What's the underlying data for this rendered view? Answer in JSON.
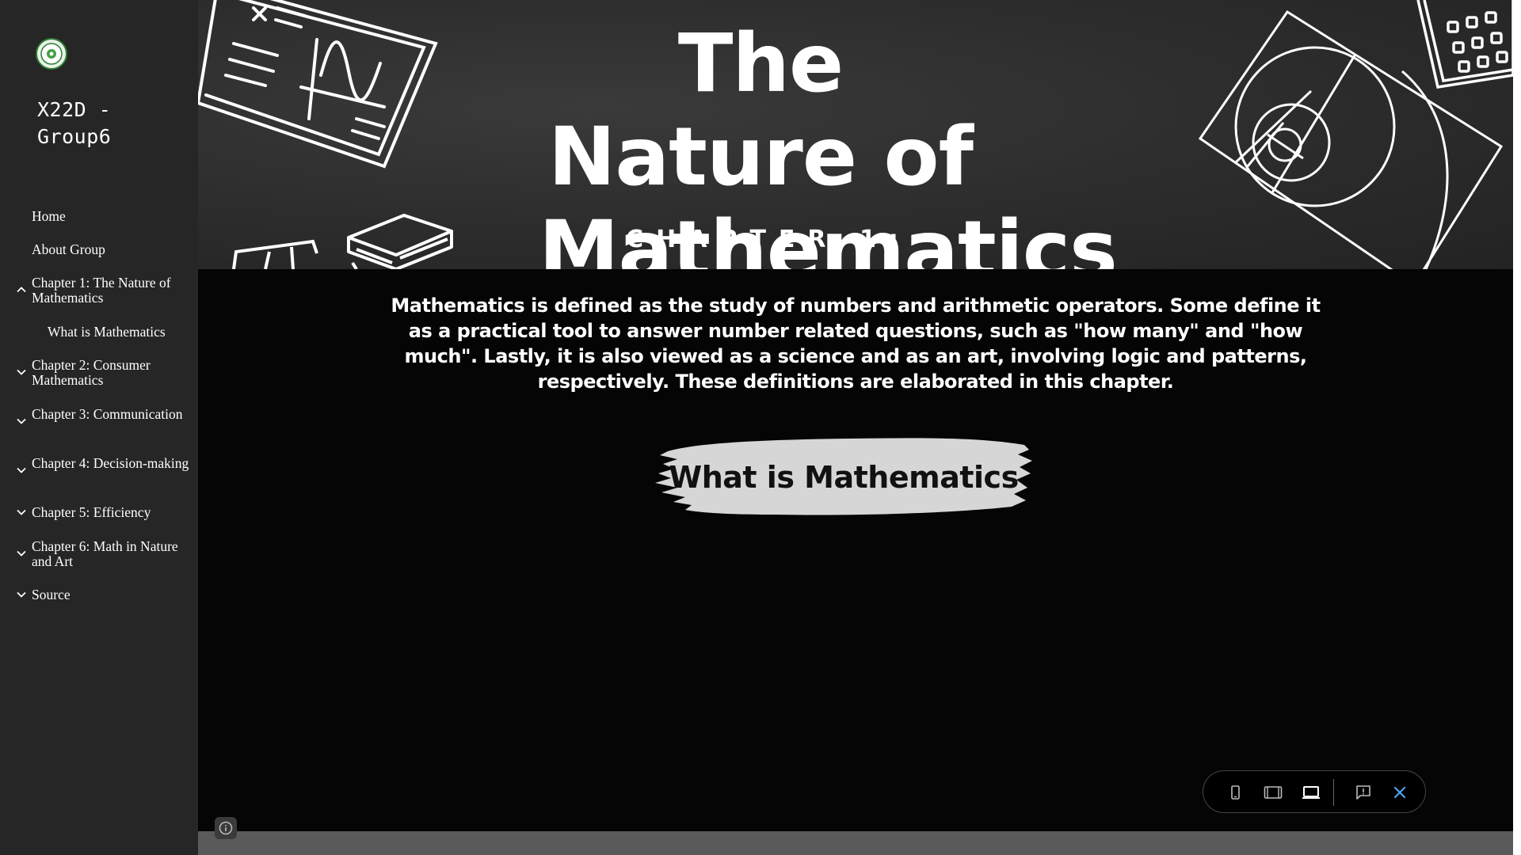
{
  "site": {
    "title": "X22D -\nGroup6",
    "logo_icon": "school-seal-icon"
  },
  "sidebar": {
    "items": [
      {
        "label": "Home",
        "expandable": false
      },
      {
        "label": "About Group",
        "expandable": false
      },
      {
        "label": "Chapter 1: The Nature of Mathematics",
        "expandable": true,
        "expanded": true
      },
      {
        "label": "What is Mathematics",
        "expandable": false,
        "sub": true
      },
      {
        "label": "Chapter 2: Consumer Mathematics",
        "expandable": true,
        "expanded": false
      },
      {
        "label": "Chapter 3: Communication",
        "expandable": true,
        "expanded": false
      },
      {
        "label": "Chapter 4: Decision-making",
        "expandable": true,
        "expanded": false
      },
      {
        "label": "Chapter 5: Efficiency",
        "expandable": true,
        "expanded": false
      },
      {
        "label": "Chapter 6: Math in Nature and Art",
        "expandable": true,
        "expanded": false
      },
      {
        "label": "Source",
        "expandable": true,
        "expanded": false
      }
    ]
  },
  "banner": {
    "title": "The Nature of Mathematics",
    "chapter": "CHAPTER 1:"
  },
  "main": {
    "intro": "Mathematics is defined as the study of numbers and arithmetic operators. Some define it as a practical tool to answer number related questions, such as \"how many\" and \"how much\". Lastly, it is also viewed as a science and as an art, involving logic and patterns, respectively. These definitions are elaborated in this chapter.",
    "cta_label": "What is Mathematics"
  },
  "preview_toolbar": {
    "buttons": [
      "phone-view-icon",
      "tablet-view-icon",
      "laptop-view-icon",
      "feedback-icon",
      "close-icon"
    ],
    "accent": "#1a73e8"
  },
  "colors": {
    "sidebar_bg": "#262626",
    "banner_bg": "#2c2c2c",
    "main_bg": "#050505",
    "cta_fill": "#d6d6d6"
  }
}
